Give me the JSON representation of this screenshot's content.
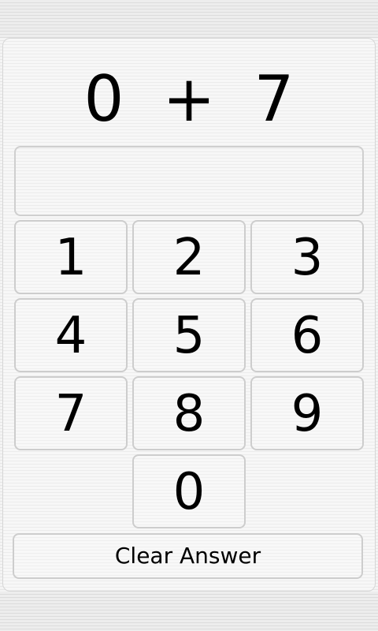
{
  "problem": {
    "operand_a": "0",
    "operator": "+",
    "operand_b": "7"
  },
  "answer": {
    "value": ""
  },
  "keypad": {
    "keys": [
      "1",
      "2",
      "3",
      "4",
      "5",
      "6",
      "7",
      "8",
      "9",
      "0"
    ]
  },
  "actions": {
    "clear_label": "Clear Answer"
  }
}
